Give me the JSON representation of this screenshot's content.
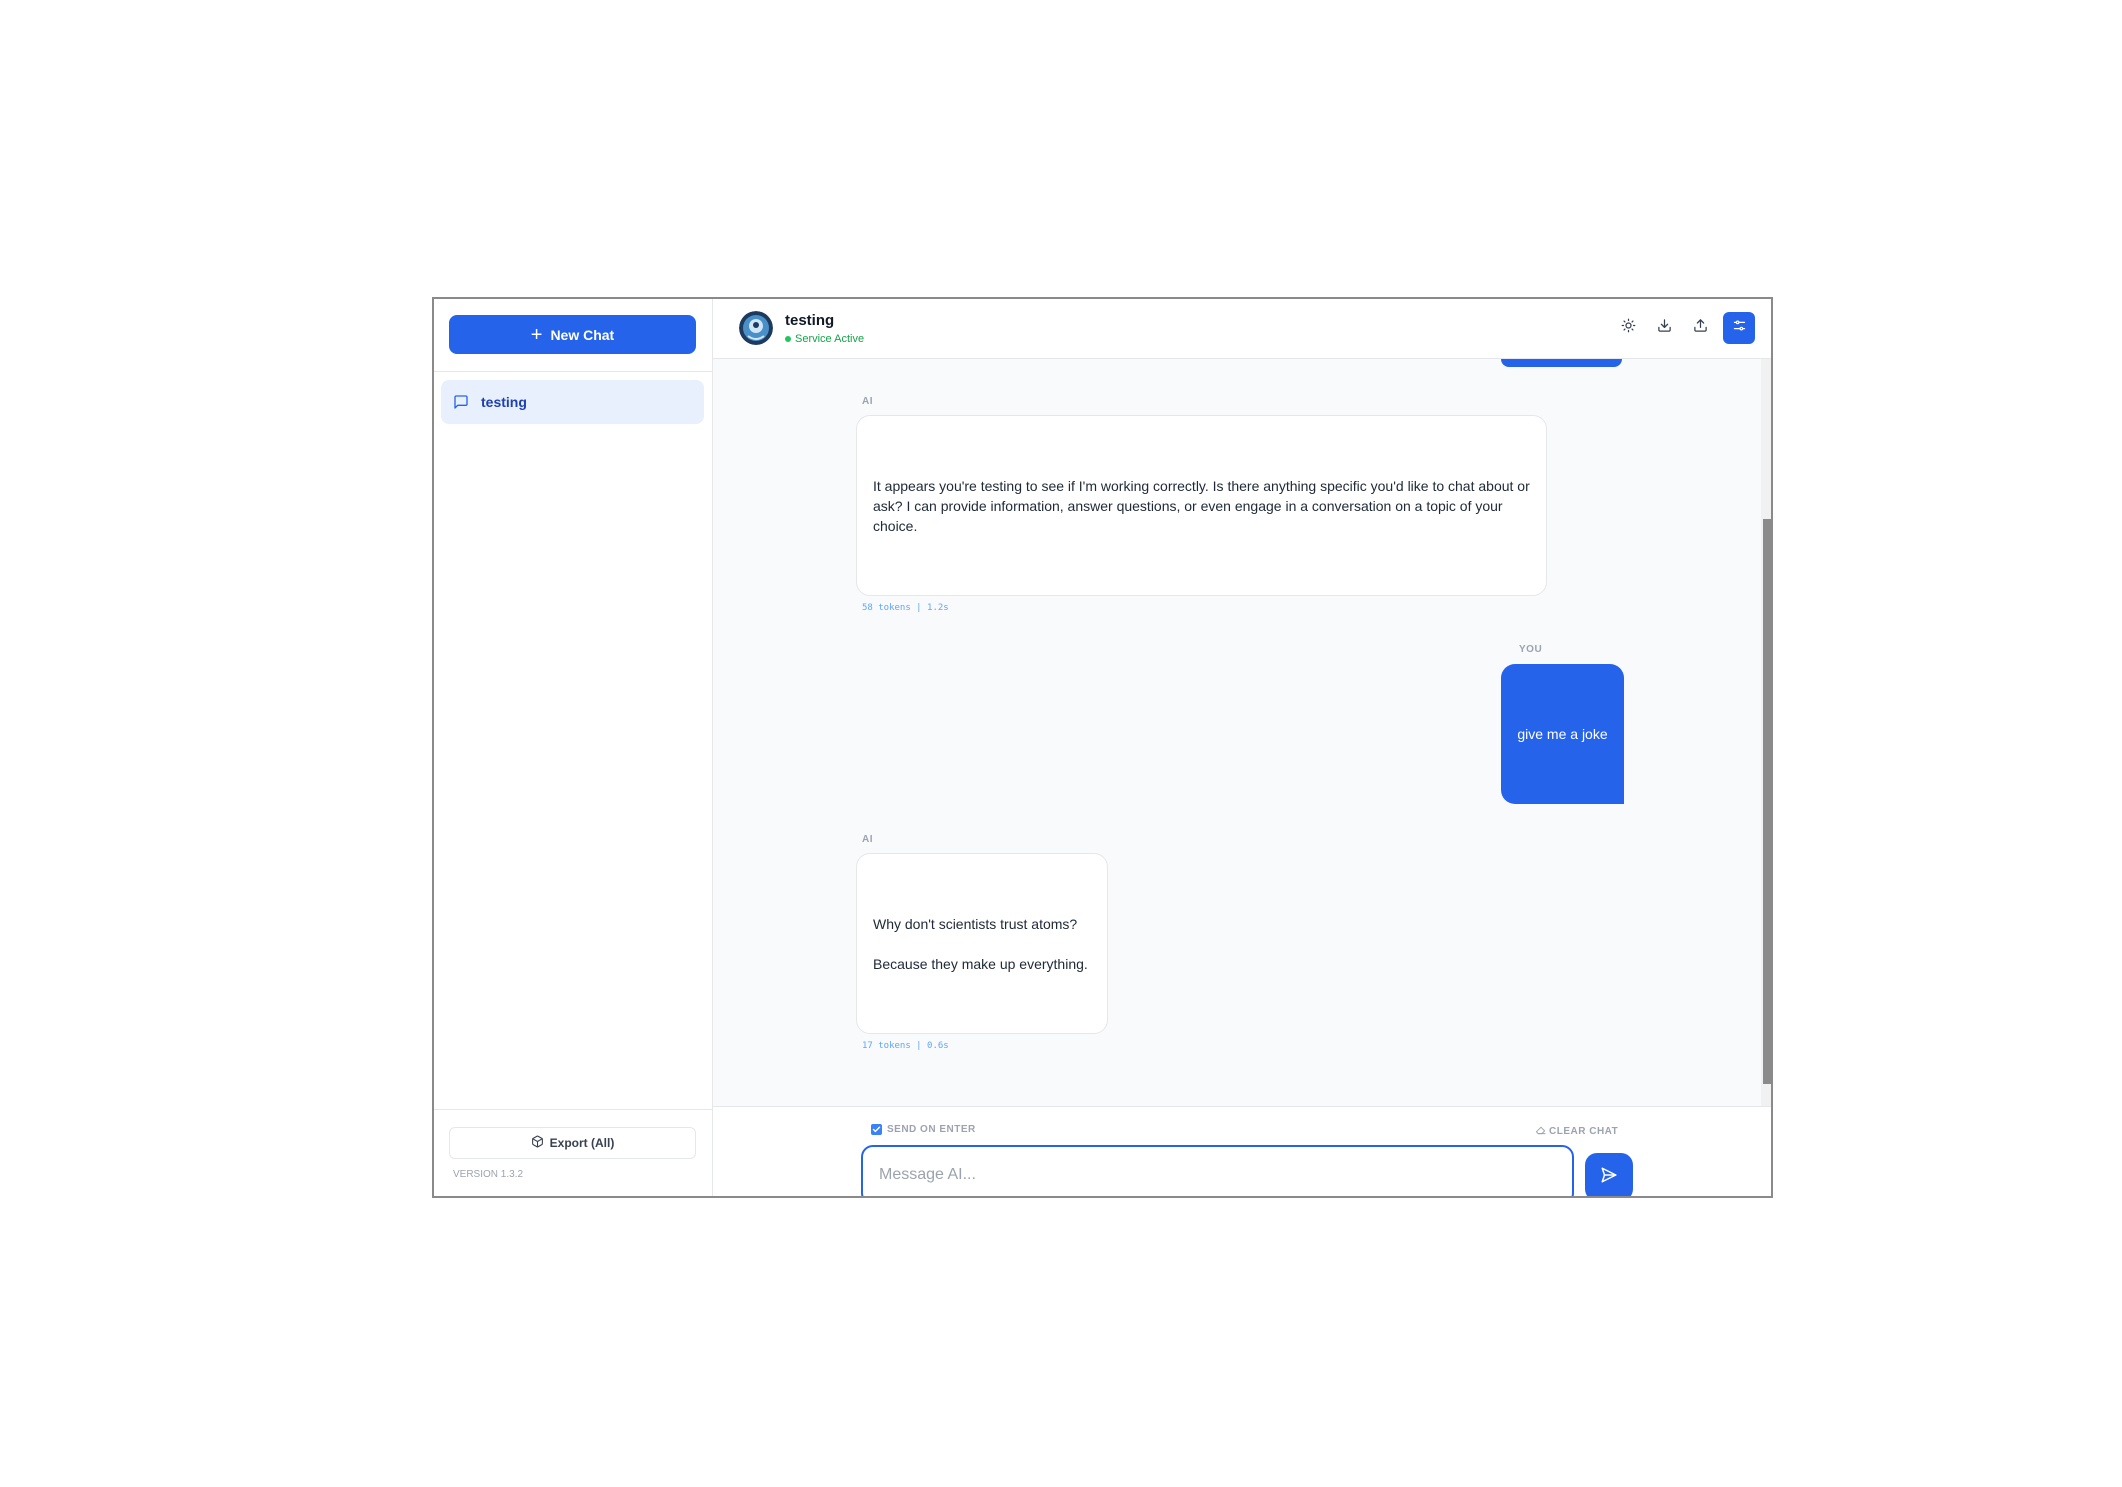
{
  "sidebar": {
    "new_chat_label": "New Chat",
    "chats": [
      {
        "label": "testing"
      }
    ],
    "export_label": "Export (All)",
    "version": "VERSION 1.3.2"
  },
  "header": {
    "title": "testing",
    "status": "Service Active",
    "icons": [
      "sun-icon",
      "download-icon",
      "upload-icon",
      "settings-sliders-icon"
    ]
  },
  "messages": [
    {
      "role": "AI",
      "text": "It appears you're testing to see if I'm working correctly. Is there anything specific you'd like to chat about or ask? I can provide information, answer questions, or even engage in a conversation on a topic of your choice.",
      "meta": "58 tokens | 1.2s"
    },
    {
      "role": "YOU",
      "text": "give me a joke"
    },
    {
      "role": "AI",
      "lines": [
        "Why don't scientists trust atoms?",
        "Because they make up everything."
      ],
      "meta": "17 tokens | 0.6s"
    }
  ],
  "composer": {
    "send_on_enter_label": "SEND ON ENTER",
    "send_on_enter_checked": true,
    "clear_chat_label": "CLEAR CHAT",
    "placeholder": "Message AI...",
    "value": ""
  },
  "colors": {
    "accent": "#2563eb",
    "status": "#16a34a",
    "active_item_bg": "#e8f0fd"
  }
}
